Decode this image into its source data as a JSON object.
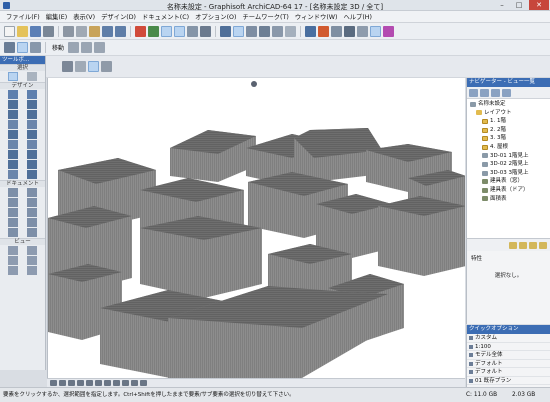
{
  "window": {
    "title": "名称未設定 - Graphisoft ArchiCAD-64 17 - [名称未設定 3D / 全て]",
    "minimize": "–",
    "maximize": "□",
    "close": "✕"
  },
  "menu": [
    "ファイル(F)",
    "編集(E)",
    "表示(V)",
    "デザイン(D)",
    "ドキュメント(C)",
    "オプション(O)",
    "チームワーク(T)",
    "ウィンドウ(W)",
    "ヘルプ(H)"
  ],
  "toolbar2": {
    "move_label": "移動"
  },
  "toolbox": {
    "header": "ツールボ...",
    "select_label": "選択",
    "design_label": "デザイン",
    "document_label": "ドキュメント",
    "view_label": "ビュー"
  },
  "navigator": {
    "header": "ナビゲーター - ビュー一覧",
    "items": [
      {
        "label": "名称未設定",
        "icon": "project",
        "indent": 0
      },
      {
        "label": "レイアウト",
        "icon": "folder",
        "indent": 1
      },
      {
        "label": "1. 1階",
        "icon": "story",
        "indent": 2
      },
      {
        "label": "2. 2階",
        "icon": "story",
        "indent": 2
      },
      {
        "label": "3. 3階",
        "icon": "story",
        "indent": 2
      },
      {
        "label": "4. 屋根",
        "icon": "story",
        "indent": 2
      },
      {
        "label": "3D-01 1階見上",
        "icon": "view-3d",
        "indent": 2
      },
      {
        "label": "3D-02 2階見上",
        "icon": "view-3d",
        "indent": 2
      },
      {
        "label": "3D-03 3階見上",
        "icon": "view-3d",
        "indent": 2
      },
      {
        "label": "建具表（窓）",
        "icon": "schedule",
        "indent": 2
      },
      {
        "label": "建具表（ドア）",
        "icon": "schedule",
        "indent": 2
      },
      {
        "label": "面積表",
        "icon": "schedule",
        "indent": 2
      }
    ]
  },
  "properties": {
    "heading": "特性",
    "value": "選択なし。"
  },
  "quick_options": {
    "header": "クイックオプション",
    "rows": [
      "カスタム",
      "1:100",
      "モデル全体",
      "デフォルト",
      "デフォルト",
      "01 既存プラン"
    ]
  },
  "status": {
    "message": "要素をクリックするか、選択範囲を指定します。Ctrl+Shiftを押したままで要素/サブ要素の選択を切り替えて下さい。",
    "disk_c": "C: 11.0 GB",
    "disk_other": "2.03 GB"
  },
  "colors": {
    "accent": "#3c6db4",
    "building": "#8c8c8c",
    "building_top": "#6d6d6d",
    "view_bg": "#ffffff"
  }
}
